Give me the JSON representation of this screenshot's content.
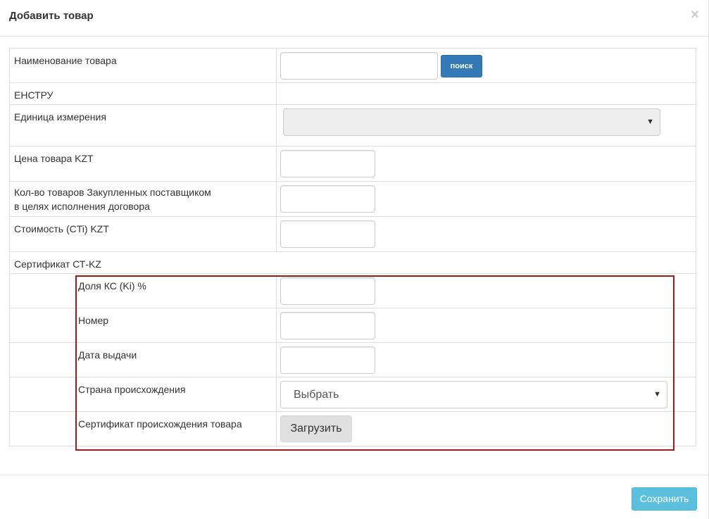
{
  "modal": {
    "title": "Добавить товар",
    "close_symbol": "×"
  },
  "product_section": {
    "name_label": "Наименование товара",
    "name_value": "",
    "search_button": "поиск",
    "enstru_label": "ЕНСТРУ",
    "enstru_value": "",
    "unit_label": "Единица измерения",
    "unit_selected": ""
  },
  "price_section": {
    "price_label": "Цена товара KZT",
    "price_value": "",
    "qty_label_line1": "Кол-во товаров Закупленных поставщиком",
    "qty_label_line2": "в целях исполнения договора",
    "qty_value": "",
    "cost_label": "Стоимость (CTi) KZT",
    "cost_value": ""
  },
  "certificate": {
    "section_label": "Сертификат СТ-KZ",
    "share_label": "Доля КС (Ki) %",
    "share_value": "",
    "number_label": "Номер",
    "number_value": "",
    "issue_date_label": "Дата выдачи",
    "issue_date_value": "",
    "country_label": "Страна происхождения",
    "country_selected": "Выбрать",
    "origin_cert_label": "Сертификат происхождения товара",
    "upload_button": "Загрузить"
  },
  "footer": {
    "save_button": "Сохранить"
  },
  "colors": {
    "primary": "#337ab7",
    "info": "#5bc0de",
    "highlight": "#a01c1c"
  }
}
